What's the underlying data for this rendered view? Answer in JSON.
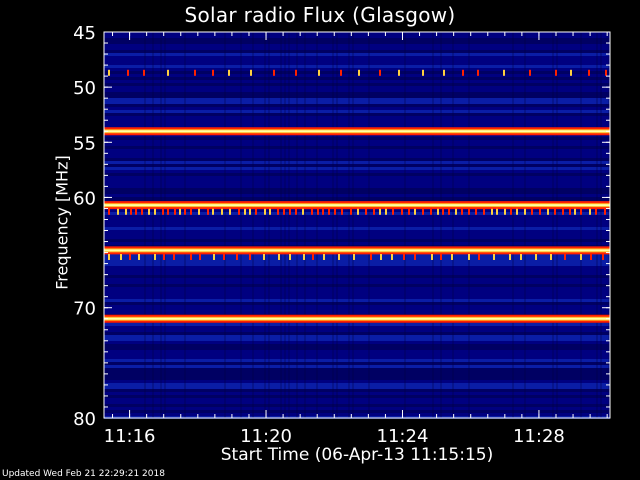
{
  "chart_data": {
    "type": "heatmap",
    "title": "Solar radio Flux (Glasgow)",
    "xlabel": "Start Time (06-Apr-13 11:15:15)",
    "ylabel": "Frequency [MHz]",
    "x_ticks": [
      "11:16",
      "11:20",
      "11:24",
      "11:28"
    ],
    "y_ticks": [
      45,
      50,
      55,
      60,
      70,
      80
    ],
    "ylim": [
      45,
      80
    ],
    "xlim": [
      "11:15:15",
      "11:30:05"
    ],
    "colors": {
      "background": "#000080",
      "dark": "#000050",
      "mid": "#1030c0",
      "bright": "#ffffa0",
      "red": "#ff2000"
    },
    "bright_bands_mhz": [
      54.0,
      60.7,
      64.8,
      71.0
    ],
    "spike_rows_mhz": [
      48.7,
      61.3,
      65.4
    ]
  },
  "footer": "Updated Wed Feb 21 22:29:21 2018"
}
